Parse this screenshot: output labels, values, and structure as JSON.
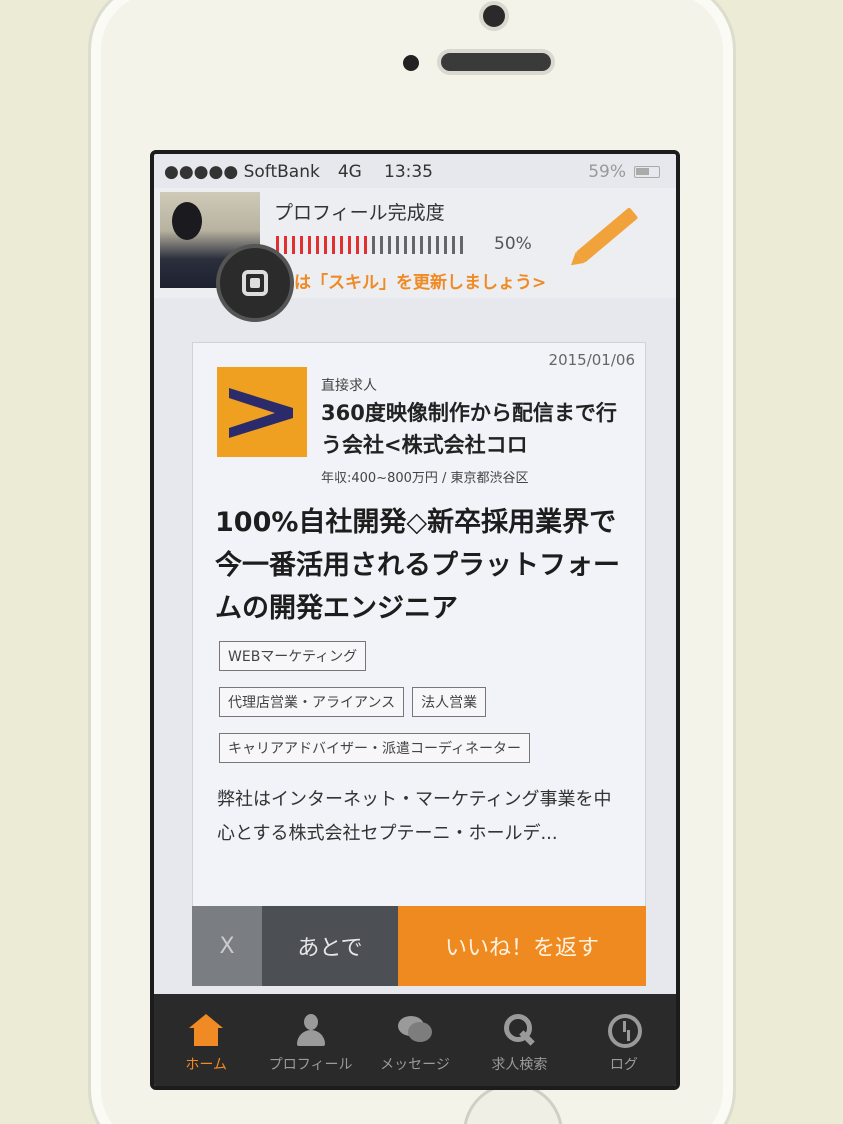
{
  "status": {
    "carrier": "●●●●● SoftBank",
    "network": "4G",
    "time": "13:35",
    "battery": "59%"
  },
  "profile": {
    "title": "プロフィール完成度",
    "progress_percent": "50%",
    "progress_value": 0.5,
    "hint": "は「スキル」を更新しましょう>"
  },
  "job": {
    "date": "2015/01/06",
    "type": "直接求人",
    "company": "360度映像制作から配信まで行う会社<株式会社コロ",
    "meta": "年収:400~800万円 / 東京都渋谷区",
    "title": "100%自社開発◇新卒採用業界で今一番活用されるプラットフォームの開発エンジニア",
    "tags": [
      "WEBマーケティング",
      "代理店営業・アライアンス",
      "法人営業",
      "キャリアアドバイザー・派遣コーディネーター"
    ],
    "description": "弊社はインターネット・マーケティング事業を中心とする株式会社セプテーニ・ホールデ..."
  },
  "actions": {
    "dismiss": "X",
    "later": "あとで",
    "like": "いいね！を返す"
  },
  "tabs": [
    {
      "label": "ホーム",
      "icon": "home-icon"
    },
    {
      "label": "プロフィール",
      "icon": "user-icon"
    },
    {
      "label": "メッセージ",
      "icon": "message-icon"
    },
    {
      "label": "求人検索",
      "icon": "search-icon"
    },
    {
      "label": "ログ",
      "icon": "clock-icon"
    }
  ],
  "colors": {
    "accent": "#f08a24",
    "logo_bg": "#f0a020",
    "logo_mark": "#2b2a6b"
  }
}
